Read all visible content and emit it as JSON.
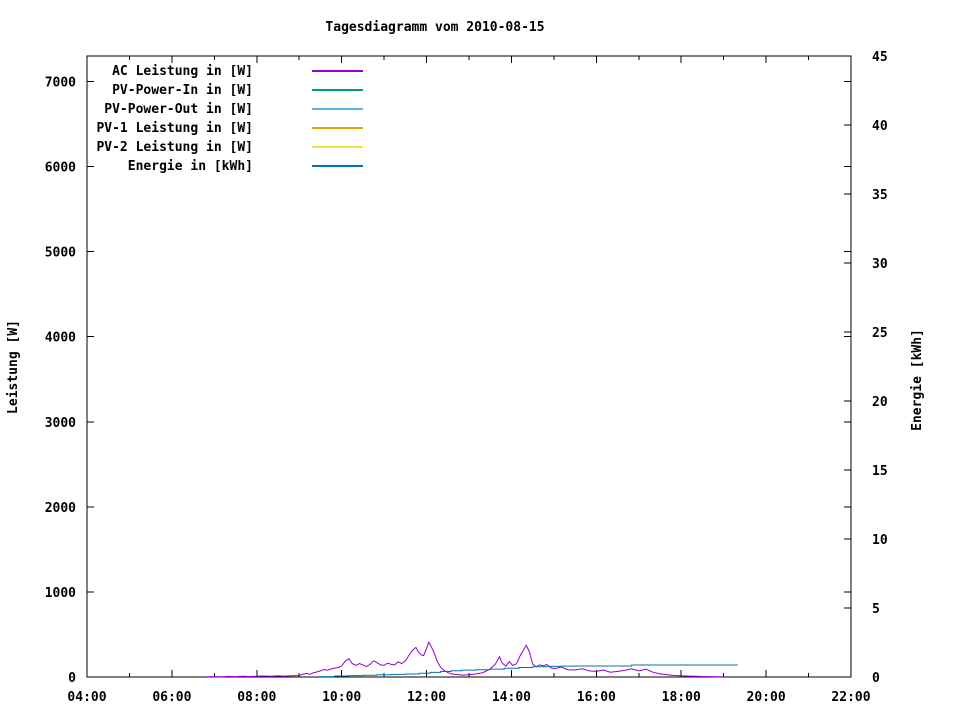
{
  "title": "Tagesdiagramm vom 2010-08-15",
  "axes": {
    "y_left_label": "Leistung [W]",
    "y_right_label": "Energie [kWh]"
  },
  "legend": {
    "items": [
      {
        "label": "AC Leistung in [W]",
        "color": "#9400D3"
      },
      {
        "label": "PV-Power-In in [W]",
        "color": "#009E73"
      },
      {
        "label": "PV-Power-Out in [W]",
        "color": "#56B4E9"
      },
      {
        "label": "PV-1 Leistung in [W]",
        "color": "#E69F00"
      },
      {
        "label": "PV-2 Leistung in [W]",
        "color": "#F0E442"
      },
      {
        "label": "Energie in [kWh]",
        "color": "#0072B2"
      }
    ]
  },
  "chart_data": {
    "type": "line",
    "title": "Tagesdiagramm vom 2010-08-15",
    "grid": false,
    "legend_position": "top-left-inside",
    "x_axis": {
      "unit": "time of day (hours)",
      "range": [
        4,
        22
      ],
      "major_ticks": [
        [
          4,
          "04:00"
        ],
        [
          6,
          "06:00"
        ],
        [
          8,
          "08:00"
        ],
        [
          10,
          "10:00"
        ],
        [
          12,
          "12:00"
        ],
        [
          14,
          "14:00"
        ],
        [
          16,
          "16:00"
        ],
        [
          18,
          "18:00"
        ],
        [
          20,
          "20:00"
        ],
        [
          22,
          "22:00"
        ]
      ],
      "minor_step_hours": 1
    },
    "y_left_axis": {
      "label": "Leistung [W]",
      "range": [
        0,
        7300
      ],
      "major_ticks": [
        [
          0,
          "0"
        ],
        [
          1000,
          "1000"
        ],
        [
          2000,
          "2000"
        ],
        [
          3000,
          "3000"
        ],
        [
          4000,
          "4000"
        ],
        [
          5000,
          "5000"
        ],
        [
          6000,
          "6000"
        ],
        [
          7000,
          "7000"
        ]
      ]
    },
    "y_right_axis": {
      "label": "Energie [kWh]",
      "range": [
        0,
        45
      ],
      "major_ticks": [
        [
          0,
          "0"
        ],
        [
          5,
          "5"
        ],
        [
          10,
          "10"
        ],
        [
          15,
          "15"
        ],
        [
          20,
          "20"
        ],
        [
          25,
          "25"
        ],
        [
          30,
          "30"
        ],
        [
          35,
          "35"
        ],
        [
          40,
          "40"
        ],
        [
          45,
          "45"
        ]
      ]
    },
    "series": [
      {
        "name": "AC Leistung in [W]",
        "color": "#9400D3",
        "axis": "left",
        "style": "line",
        "points": [
          [
            6.8,
            3
          ],
          [
            7.0,
            5
          ],
          [
            7.17,
            4
          ],
          [
            7.33,
            7
          ],
          [
            7.5,
            5
          ],
          [
            7.67,
            8
          ],
          [
            7.83,
            6
          ],
          [
            8.0,
            8
          ],
          [
            8.17,
            12
          ],
          [
            8.33,
            9
          ],
          [
            8.5,
            13
          ],
          [
            8.67,
            10
          ],
          [
            8.83,
            14
          ],
          [
            9.0,
            18
          ],
          [
            9.08,
            30
          ],
          [
            9.17,
            42
          ],
          [
            9.25,
            32
          ],
          [
            9.33,
            48
          ],
          [
            9.42,
            60
          ],
          [
            9.5,
            72
          ],
          [
            9.58,
            88
          ],
          [
            9.67,
            80
          ],
          [
            9.75,
            95
          ],
          [
            9.83,
            105
          ],
          [
            9.92,
            112
          ],
          [
            10.0,
            130
          ],
          [
            10.08,
            185
          ],
          [
            10.17,
            215
          ],
          [
            10.25,
            158
          ],
          [
            10.33,
            138
          ],
          [
            10.42,
            158
          ],
          [
            10.5,
            142
          ],
          [
            10.58,
            122
          ],
          [
            10.67,
            148
          ],
          [
            10.75,
            192
          ],
          [
            10.83,
            168
          ],
          [
            10.92,
            142
          ],
          [
            11.0,
            136
          ],
          [
            11.08,
            162
          ],
          [
            11.17,
            148
          ],
          [
            11.25,
            142
          ],
          [
            11.33,
            178
          ],
          [
            11.42,
            158
          ],
          [
            11.5,
            188
          ],
          [
            11.58,
            252
          ],
          [
            11.67,
            315
          ],
          [
            11.75,
            348
          ],
          [
            11.8,
            298
          ],
          [
            11.87,
            262
          ],
          [
            11.93,
            252
          ],
          [
            12.0,
            335
          ],
          [
            12.05,
            408
          ],
          [
            12.1,
            368
          ],
          [
            12.17,
            295
          ],
          [
            12.25,
            185
          ],
          [
            12.33,
            115
          ],
          [
            12.42,
            75
          ],
          [
            12.5,
            52
          ],
          [
            12.58,
            38
          ],
          [
            12.67,
            30
          ],
          [
            12.83,
            22
          ],
          [
            13.0,
            26
          ],
          [
            13.17,
            36
          ],
          [
            13.33,
            52
          ],
          [
            13.5,
            95
          ],
          [
            13.62,
            150
          ],
          [
            13.72,
            238
          ],
          [
            13.78,
            165
          ],
          [
            13.87,
            128
          ],
          [
            13.95,
            182
          ],
          [
            14.03,
            135
          ],
          [
            14.12,
            155
          ],
          [
            14.2,
            245
          ],
          [
            14.28,
            315
          ],
          [
            14.35,
            372
          ],
          [
            14.42,
            298
          ],
          [
            14.5,
            152
          ],
          [
            14.58,
            122
          ],
          [
            14.67,
            142
          ],
          [
            14.75,
            132
          ],
          [
            14.83,
            148
          ],
          [
            14.92,
            112
          ],
          [
            15.0,
            96
          ],
          [
            15.17,
            118
          ],
          [
            15.33,
            86
          ],
          [
            15.5,
            82
          ],
          [
            15.67,
            96
          ],
          [
            15.83,
            72
          ],
          [
            16.0,
            66
          ],
          [
            16.17,
            82
          ],
          [
            16.33,
            56
          ],
          [
            16.5,
            66
          ],
          [
            16.67,
            78
          ],
          [
            16.83,
            96
          ],
          [
            17.0,
            72
          ],
          [
            17.17,
            92
          ],
          [
            17.33,
            56
          ],
          [
            17.5,
            36
          ],
          [
            17.67,
            26
          ],
          [
            17.83,
            18
          ],
          [
            18.0,
            14
          ],
          [
            18.17,
            10
          ],
          [
            18.33,
            8
          ],
          [
            18.5,
            6
          ],
          [
            18.67,
            5
          ],
          [
            18.83,
            4
          ],
          [
            19.0,
            3
          ]
        ]
      },
      {
        "name": "PV-Power-In in [W]",
        "color": "#009E73",
        "axis": "left",
        "style": "line",
        "points": []
      },
      {
        "name": "PV-Power-Out in [W]",
        "color": "#56B4E9",
        "axis": "left",
        "style": "line",
        "points": []
      },
      {
        "name": "PV-1 Leistung in [W]",
        "color": "#E69F00",
        "axis": "left",
        "style": "line",
        "points": []
      },
      {
        "name": "PV-2 Leistung in [W]",
        "color": "#F0E442",
        "axis": "left",
        "style": "line",
        "points": []
      },
      {
        "name": "Energie in [kWh]",
        "color": "#0072B2",
        "axis": "right",
        "style": "step",
        "points": [
          [
            9.5,
            0.03
          ],
          [
            9.83,
            0.07
          ],
          [
            10.17,
            0.1
          ],
          [
            10.5,
            0.13
          ],
          [
            10.83,
            0.16
          ],
          [
            11.17,
            0.19
          ],
          [
            11.5,
            0.22
          ],
          [
            11.83,
            0.27
          ],
          [
            12.08,
            0.33
          ],
          [
            12.33,
            0.4
          ],
          [
            12.58,
            0.46
          ],
          [
            12.83,
            0.5
          ],
          [
            13.17,
            0.53
          ],
          [
            13.5,
            0.57
          ],
          [
            13.83,
            0.63
          ],
          [
            14.17,
            0.69
          ],
          [
            14.5,
            0.74
          ],
          [
            14.83,
            0.77
          ],
          [
            15.17,
            0.79
          ],
          [
            15.5,
            0.8
          ],
          [
            16.83,
            0.87
          ],
          [
            19.33,
            0.87
          ]
        ]
      }
    ]
  }
}
